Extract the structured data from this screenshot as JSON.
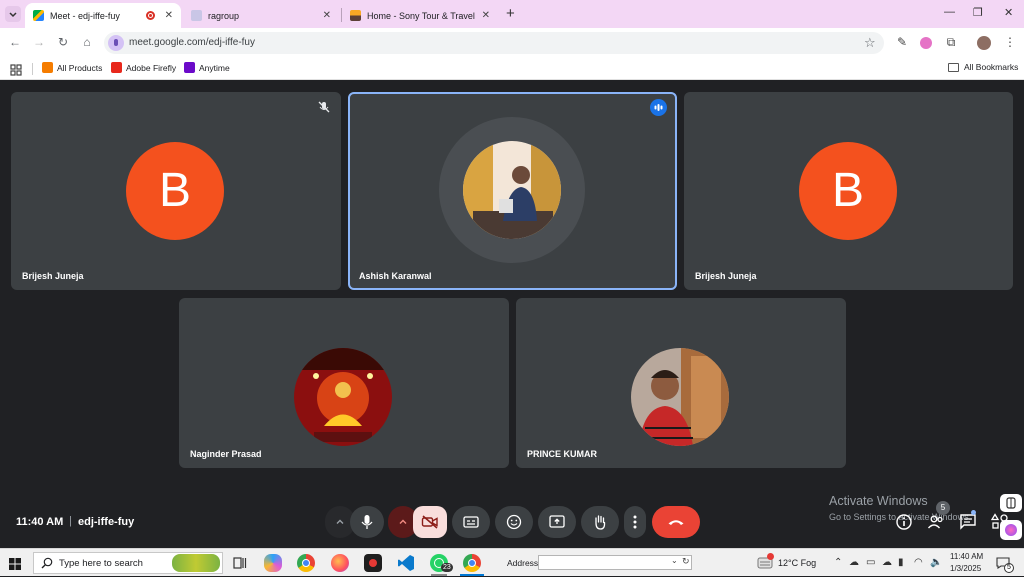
{
  "browser": {
    "tabs": [
      {
        "title": "Meet - edj-iffe-fuy",
        "active": true
      },
      {
        "title": "ragroup",
        "active": false
      },
      {
        "title": "Home - Sony Tour & Travel",
        "active": false
      }
    ],
    "new_tab": "+",
    "url": "meet.google.com/edj-iffe-fuy",
    "bookmarks": [
      {
        "label": "All Products",
        "color": "#f57c00"
      },
      {
        "label": "Adobe Firefly",
        "color": "#e8281c"
      },
      {
        "label": "Anytime",
        "color": "#6b0ac9"
      }
    ],
    "all_bookmarks": "All Bookmarks"
  },
  "meet": {
    "participants": [
      {
        "name": "Brijesh Juneja",
        "avatar_letter": "B",
        "muted": true
      },
      {
        "name": "Ashish Karanwal",
        "speaking": true
      },
      {
        "name": "Brijesh Juneja",
        "avatar_letter": "B"
      },
      {
        "name": "Naginder Prasad"
      },
      {
        "name": "PRINCE KUMAR"
      }
    ],
    "time": "11:40 AM",
    "separator": "|",
    "meeting_code": "edj-iffe-fuy",
    "people_count": "5",
    "accent": "#8ab4f8",
    "danger": "#ea4335"
  },
  "watermark": {
    "line1": "Activate Windows",
    "line2": "Go to Settings to activate Windows."
  },
  "taskbar": {
    "search_placeholder": "Type here to search",
    "address_label": "Address",
    "whatsapp_badge": "23",
    "weather": "12°C  Fog",
    "time": "11:40 AM",
    "date": "1/3/2025",
    "notification_count": "5"
  }
}
